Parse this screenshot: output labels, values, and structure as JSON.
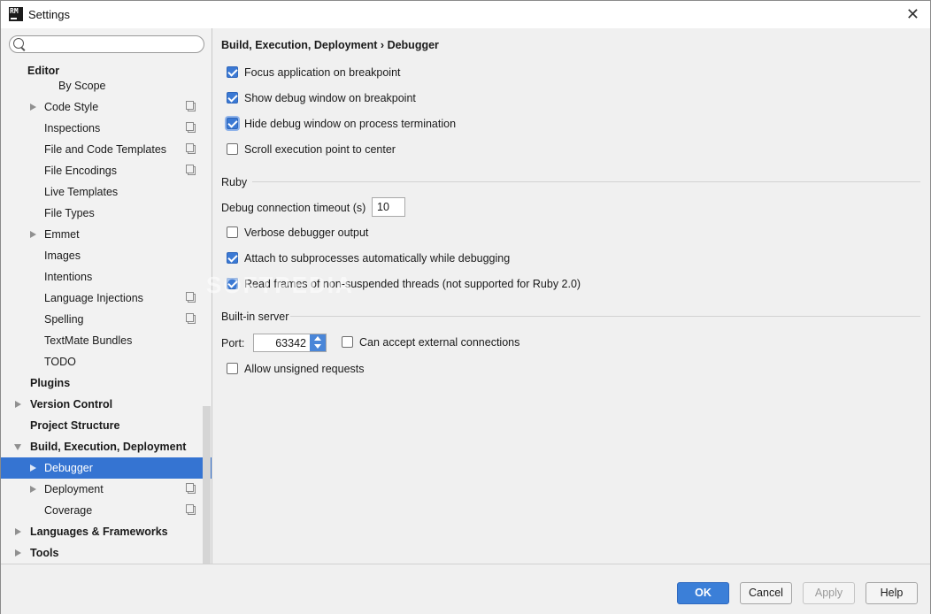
{
  "window": {
    "title": "Settings",
    "app_icon_text": "RM"
  },
  "search": {
    "placeholder": "",
    "value": ""
  },
  "sidebar": {
    "items": [
      {
        "label": "Editor"
      },
      {
        "label": "By Scope"
      },
      {
        "label": "Code Style"
      },
      {
        "label": "Inspections"
      },
      {
        "label": "File and Code Templates"
      },
      {
        "label": "File Encodings"
      },
      {
        "label": "Live Templates"
      },
      {
        "label": "File Types"
      },
      {
        "label": "Emmet"
      },
      {
        "label": "Images"
      },
      {
        "label": "Intentions"
      },
      {
        "label": "Language Injections"
      },
      {
        "label": "Spelling"
      },
      {
        "label": "TextMate Bundles"
      },
      {
        "label": "TODO"
      },
      {
        "label": "Plugins"
      },
      {
        "label": "Version Control"
      },
      {
        "label": "Project Structure"
      },
      {
        "label": "Build, Execution, Deployment"
      },
      {
        "label": "Debugger"
      },
      {
        "label": "Deployment"
      },
      {
        "label": "Coverage"
      },
      {
        "label": "Languages & Frameworks"
      },
      {
        "label": "Tools"
      }
    ]
  },
  "breadcrumb": {
    "parent": "Build, Execution, Deployment",
    "separator": "›",
    "current": "Debugger"
  },
  "debugger": {
    "options": [
      {
        "label": "Focus application on breakpoint",
        "checked": true
      },
      {
        "label": "Show debug window on breakpoint",
        "checked": true
      },
      {
        "label": "Hide debug window on process termination",
        "checked": true
      },
      {
        "label": "Scroll execution point to center",
        "checked": false
      }
    ]
  },
  "ruby": {
    "section_title": "Ruby",
    "timeout_label": "Debug connection timeout (s)",
    "timeout_value": "10",
    "options": [
      {
        "label": "Verbose debugger output",
        "checked": false
      },
      {
        "label": "Attach to subprocesses automatically while debugging",
        "checked": true
      },
      {
        "label": "Read frames of non-suspended threads (not supported for Ruby 2.0)",
        "checked": true
      }
    ]
  },
  "server": {
    "section_title": "Built-in server",
    "port_label": "Port:",
    "port_value": "63342",
    "external_label": "Can accept external connections",
    "external_checked": false,
    "unsigned_label": "Allow unsigned requests",
    "unsigned_checked": false
  },
  "watermark": "SOFTPEDIA",
  "footer": {
    "ok": "OK",
    "cancel": "Cancel",
    "apply": "Apply",
    "help": "Help"
  },
  "colors": {
    "selection": "#3574d2",
    "checkbox_on": "#3b79d4",
    "primary_button": "#3b7fd8"
  }
}
